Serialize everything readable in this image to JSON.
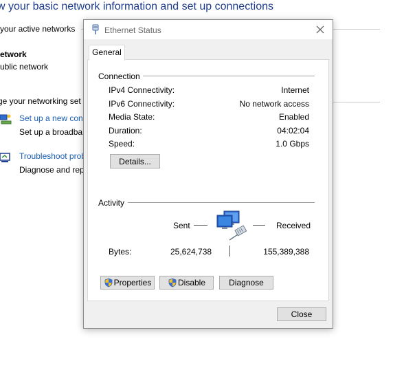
{
  "background": {
    "title": "w your basic network information and set up connections",
    "active_networks_label": "your active networks",
    "network_name": "etwork",
    "network_type": "ublic network",
    "networking_settings_label": "ge your networking set",
    "setup_link": "Set up a new conn",
    "setup_desc": "Set up a broadban",
    "troubleshoot_link": "Troubleshoot prob",
    "troubleshoot_desc": "Diagnose and repa"
  },
  "dialog": {
    "title": "Ethernet Status",
    "tab_general": "General",
    "connection": {
      "label": "Connection",
      "rows": [
        {
          "label": "IPv4 Connectivity:",
          "value": "Internet"
        },
        {
          "label": "IPv6 Connectivity:",
          "value": "No network access"
        },
        {
          "label": "Media State:",
          "value": "Enabled"
        },
        {
          "label": "Duration:",
          "value": "04:02:04"
        },
        {
          "label": "Speed:",
          "value": "1.0 Gbps"
        }
      ],
      "details_button": "Details..."
    },
    "activity": {
      "label": "Activity",
      "sent_label": "Sent",
      "received_label": "Received",
      "bytes_label": "Bytes:",
      "bytes_sent": "25,624,738",
      "bytes_received": "155,389,388"
    },
    "buttons": {
      "properties": "Properties",
      "disable": "Disable",
      "diagnose": "Diagnose",
      "close": "Close"
    }
  },
  "colors": {
    "link": "#1a5fb4",
    "title_blue": "#1e3c8c",
    "dialog_bg": "#f0f0f0",
    "button_bg": "#e1e1e1"
  },
  "icons": [
    "network-adapter-icon",
    "close-icon",
    "setup-connection-icon",
    "troubleshoot-icon",
    "network-computers-icon",
    "uac-shield-icon"
  ]
}
